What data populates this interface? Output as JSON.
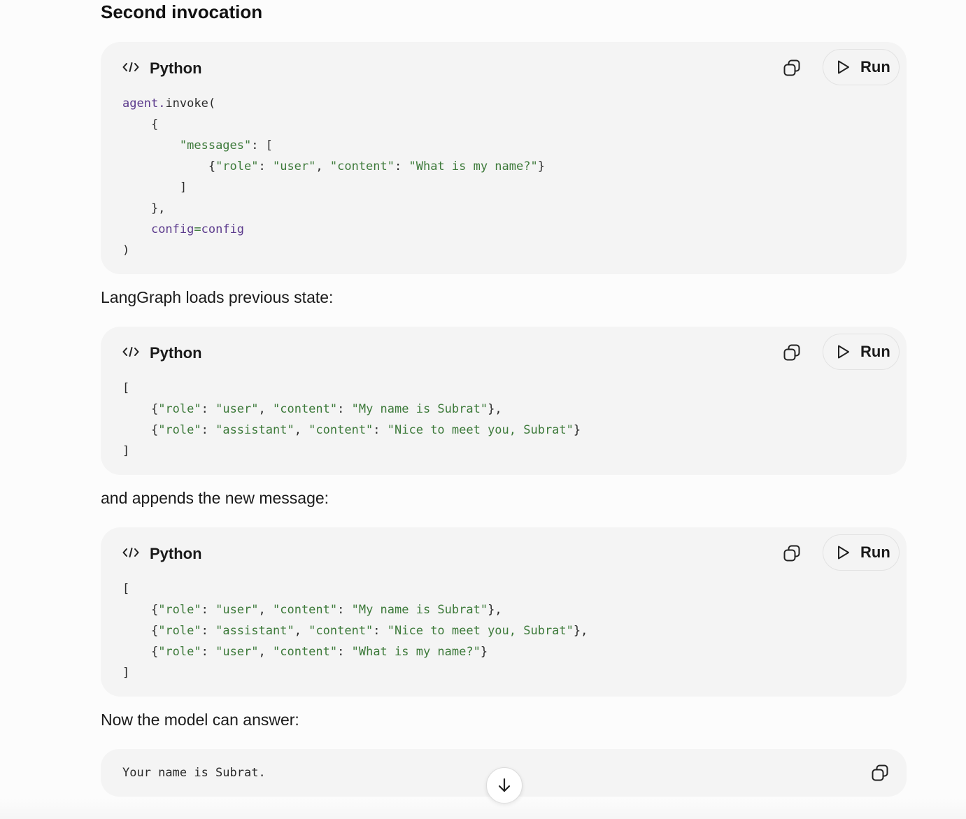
{
  "section_heading": "Second invocation",
  "code_blocks": [
    {
      "language": "Python",
      "copy_icon": "copy-icon",
      "run_label": "Run",
      "lines": [
        [
          {
            "t": "agent",
            "c": "var"
          },
          {
            "t": ".",
            "c": "var"
          },
          {
            "t": "invoke(",
            "c": "plain"
          }
        ],
        [
          {
            "t": "    {",
            "c": "plain"
          }
        ],
        [
          {
            "t": "        ",
            "c": "plain"
          },
          {
            "t": "\"messages\"",
            "c": "str"
          },
          {
            "t": ": [",
            "c": "plain"
          }
        ],
        [
          {
            "t": "            {",
            "c": "plain"
          },
          {
            "t": "\"role\"",
            "c": "str"
          },
          {
            "t": ": ",
            "c": "plain"
          },
          {
            "t": "\"user\"",
            "c": "str"
          },
          {
            "t": ", ",
            "c": "plain"
          },
          {
            "t": "\"content\"",
            "c": "str"
          },
          {
            "t": ": ",
            "c": "plain"
          },
          {
            "t": "\"What is my name?\"",
            "c": "str"
          },
          {
            "t": "}",
            "c": "plain"
          }
        ],
        [
          {
            "t": "        ]",
            "c": "plain"
          }
        ],
        [
          {
            "t": "    },",
            "c": "plain"
          }
        ],
        [
          {
            "t": "    ",
            "c": "plain"
          },
          {
            "t": "config",
            "c": "var"
          },
          {
            "t": "=",
            "c": "op"
          },
          {
            "t": "config",
            "c": "var"
          }
        ],
        [
          {
            "t": ")",
            "c": "plain"
          }
        ]
      ]
    },
    {
      "language": "Python",
      "copy_icon": "copy-icon",
      "run_label": "Run",
      "lines": [
        [
          {
            "t": "[",
            "c": "plain"
          }
        ],
        [
          {
            "t": "    {",
            "c": "plain"
          },
          {
            "t": "\"role\"",
            "c": "str"
          },
          {
            "t": ": ",
            "c": "plain"
          },
          {
            "t": "\"user\"",
            "c": "str"
          },
          {
            "t": ", ",
            "c": "plain"
          },
          {
            "t": "\"content\"",
            "c": "str"
          },
          {
            "t": ": ",
            "c": "plain"
          },
          {
            "t": "\"My name is Subrat\"",
            "c": "str"
          },
          {
            "t": "},",
            "c": "plain"
          }
        ],
        [
          {
            "t": "    {",
            "c": "plain"
          },
          {
            "t": "\"role\"",
            "c": "str"
          },
          {
            "t": ": ",
            "c": "plain"
          },
          {
            "t": "\"assistant\"",
            "c": "str"
          },
          {
            "t": ", ",
            "c": "plain"
          },
          {
            "t": "\"content\"",
            "c": "str"
          },
          {
            "t": ": ",
            "c": "plain"
          },
          {
            "t": "\"Nice to meet you, Subrat\"",
            "c": "str"
          },
          {
            "t": "}",
            "c": "plain"
          }
        ],
        [
          {
            "t": "]",
            "c": "plain"
          }
        ]
      ]
    },
    {
      "language": "Python",
      "copy_icon": "copy-icon",
      "run_label": "Run",
      "lines": [
        [
          {
            "t": "[",
            "c": "plain"
          }
        ],
        [
          {
            "t": "    {",
            "c": "plain"
          },
          {
            "t": "\"role\"",
            "c": "str"
          },
          {
            "t": ": ",
            "c": "plain"
          },
          {
            "t": "\"user\"",
            "c": "str"
          },
          {
            "t": ", ",
            "c": "plain"
          },
          {
            "t": "\"content\"",
            "c": "str"
          },
          {
            "t": ": ",
            "c": "plain"
          },
          {
            "t": "\"My name is Subrat\"",
            "c": "str"
          },
          {
            "t": "},",
            "c": "plain"
          }
        ],
        [
          {
            "t": "    {",
            "c": "plain"
          },
          {
            "t": "\"role\"",
            "c": "str"
          },
          {
            "t": ": ",
            "c": "plain"
          },
          {
            "t": "\"assistant\"",
            "c": "str"
          },
          {
            "t": ", ",
            "c": "plain"
          },
          {
            "t": "\"content\"",
            "c": "str"
          },
          {
            "t": ": ",
            "c": "plain"
          },
          {
            "t": "\"Nice to meet you, Subrat\"",
            "c": "str"
          },
          {
            "t": "},",
            "c": "plain"
          }
        ],
        [
          {
            "t": "    {",
            "c": "plain"
          },
          {
            "t": "\"role\"",
            "c": "str"
          },
          {
            "t": ": ",
            "c": "plain"
          },
          {
            "t": "\"user\"",
            "c": "str"
          },
          {
            "t": ", ",
            "c": "plain"
          },
          {
            "t": "\"content\"",
            "c": "str"
          },
          {
            "t": ": ",
            "c": "plain"
          },
          {
            "t": "\"What is my name?\"",
            "c": "str"
          },
          {
            "t": "}",
            "c": "plain"
          }
        ],
        [
          {
            "t": "]",
            "c": "plain"
          }
        ]
      ]
    }
  ],
  "paragraphs": {
    "loads_state": "LangGraph loads previous state:",
    "appends": "and appends the new message:",
    "answer_intro": "Now the model can answer:"
  },
  "output_block": {
    "text": "Your name is Subrat.",
    "copy_icon": "copy-icon"
  },
  "scroll_button_icon": "arrow-down-icon",
  "colors": {
    "page_bg": "#fcfcfc",
    "card_bg": "#f4f4f4",
    "string": "#3d7a3a",
    "identifier": "#5b3a8c"
  }
}
